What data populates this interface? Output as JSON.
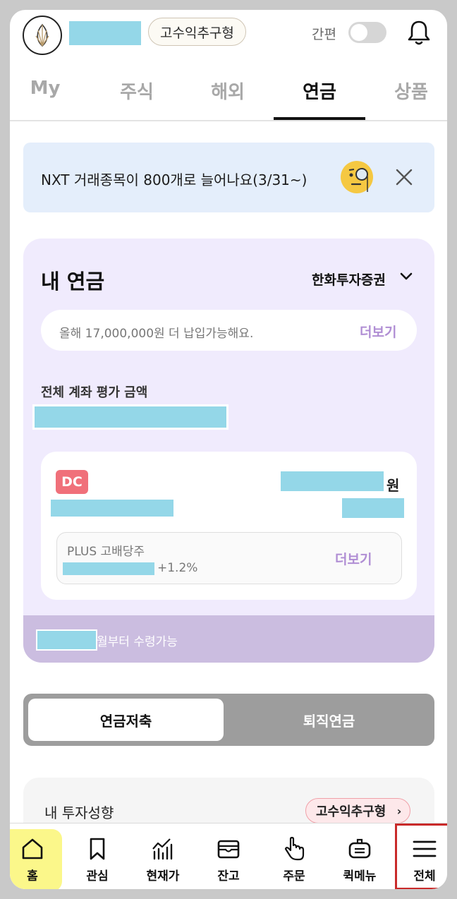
{
  "header": {
    "badge_label": "고수익추구형",
    "easy_mode_label": "간편",
    "easy_mode_on": false
  },
  "tabs": [
    {
      "label": "My",
      "active": false
    },
    {
      "label": "주식",
      "active": false
    },
    {
      "label": "해외",
      "active": false
    },
    {
      "label": "연금",
      "active": true
    },
    {
      "label": "상품",
      "active": false
    }
  ],
  "banner": {
    "text": "NXT 거래종목이 800개로 늘어나요(3/31~)",
    "icon": "monocle-face-icon"
  },
  "pension": {
    "title": "내 연금",
    "broker": "한화투자증권",
    "notice": "올해 17,000,000원 더 납입가능해요.",
    "notice_more": "더보기",
    "eval_label": "전체 계좌 평가 금액",
    "account": {
      "type_badge": "DC",
      "currency_unit": "원",
      "holding_name": "PLUS 고배당주",
      "holding_return": "+1.2%",
      "holding_more": "더보기"
    },
    "receive_suffix": "월부터 수령가능"
  },
  "segment": {
    "options": [
      "연금저축",
      "퇴직연금"
    ],
    "selected": "연금저축"
  },
  "investment": {
    "label": "내 투자성향",
    "badge": "고수익추구형",
    "chevron": "›"
  },
  "bottom_nav": [
    {
      "label": "홈",
      "icon": "home-icon",
      "highlighted": true
    },
    {
      "label": "관심",
      "icon": "bookmark-icon"
    },
    {
      "label": "현재가",
      "icon": "chart-icon"
    },
    {
      "label": "잔고",
      "icon": "wallet-icon"
    },
    {
      "label": "주문",
      "icon": "hand-pointer-icon"
    },
    {
      "label": "퀵메뉴",
      "icon": "quick-menu-icon"
    },
    {
      "label": "전체",
      "icon": "hamburger-icon",
      "boxed": true
    }
  ],
  "colors": {
    "banner_bg": "#e4eefb",
    "pension_bg": "#f0ebfd",
    "accent_purple": "#b08ed4",
    "dc_badge": "#f0707a",
    "redaction": "#94d7e8"
  }
}
